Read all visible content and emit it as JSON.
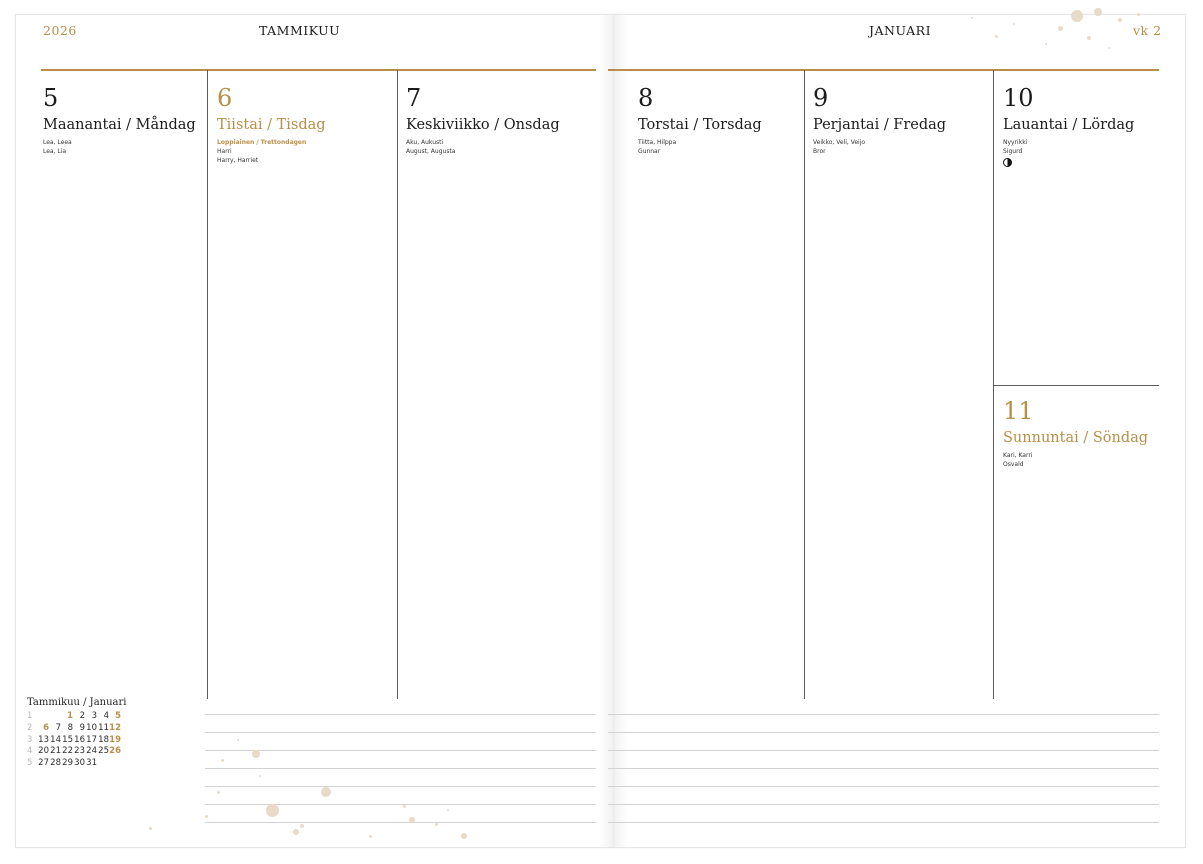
{
  "header": {
    "year": "2026",
    "month_fi": "TAMMIKUU",
    "month_sv": "JANUARI",
    "week": "vk 2"
  },
  "days": [
    {
      "num": "5",
      "name": "Maanantai / Måndag",
      "holiday": "",
      "names": [
        "Lea, Leea",
        "Lea, Lia"
      ],
      "highlight": false
    },
    {
      "num": "6",
      "name": "Tiistai / Tisdag",
      "holiday": "Loppiainen / Trettondagen",
      "names": [
        "Harri",
        "Harry, Harriet"
      ],
      "highlight": true
    },
    {
      "num": "7",
      "name": "Keskiviikko / Onsdag",
      "holiday": "",
      "names": [
        "Aku, Aukusti",
        "August, Augusta"
      ],
      "highlight": false
    },
    {
      "num": "8",
      "name": "Torstai / Torsdag",
      "holiday": "",
      "names": [
        "Tiitta, Hilppa",
        "Gunnar"
      ],
      "highlight": false
    },
    {
      "num": "9",
      "name": "Perjantai / Fredag",
      "holiday": "",
      "names": [
        "Veikko, Veli, Veijo",
        "Bror"
      ],
      "highlight": false
    },
    {
      "num": "10",
      "name": "Lauantai / Lördag",
      "holiday": "",
      "names": [
        "Nyyrikki",
        "Sigurd"
      ],
      "highlight": false,
      "moon_icon": "first-quarter-moon-icon"
    },
    {
      "num": "11",
      "name": "Sunnuntai / Söndag",
      "holiday": "",
      "names": [
        "Kari, Karri",
        "Osvald"
      ],
      "highlight": true
    }
  ],
  "mini_calendar": {
    "title": "Tammikuu / Januari",
    "rows": [
      {
        "week": "1",
        "days": [
          "",
          "",
          "1",
          "2",
          "3",
          "4",
          "5"
        ]
      },
      {
        "week": "2",
        "days": [
          "6",
          "7",
          "8",
          "9",
          "10",
          "11",
          "12"
        ]
      },
      {
        "week": "3",
        "days": [
          "13",
          "14",
          "15",
          "16",
          "17",
          "18",
          "19"
        ]
      },
      {
        "week": "4",
        "days": [
          "20",
          "21",
          "22",
          "23",
          "24",
          "25",
          "26"
        ]
      },
      {
        "week": "5",
        "days": [
          "27",
          "28",
          "29",
          "30",
          "31",
          "",
          ""
        ]
      }
    ],
    "highlighted_days": [
      "1",
      "5",
      "6",
      "12",
      "19",
      "26"
    ]
  },
  "colors": {
    "accent_gold": "#b88f49",
    "rule_gray": "#5c5c5c",
    "note_line": "#d2d2d2"
  }
}
